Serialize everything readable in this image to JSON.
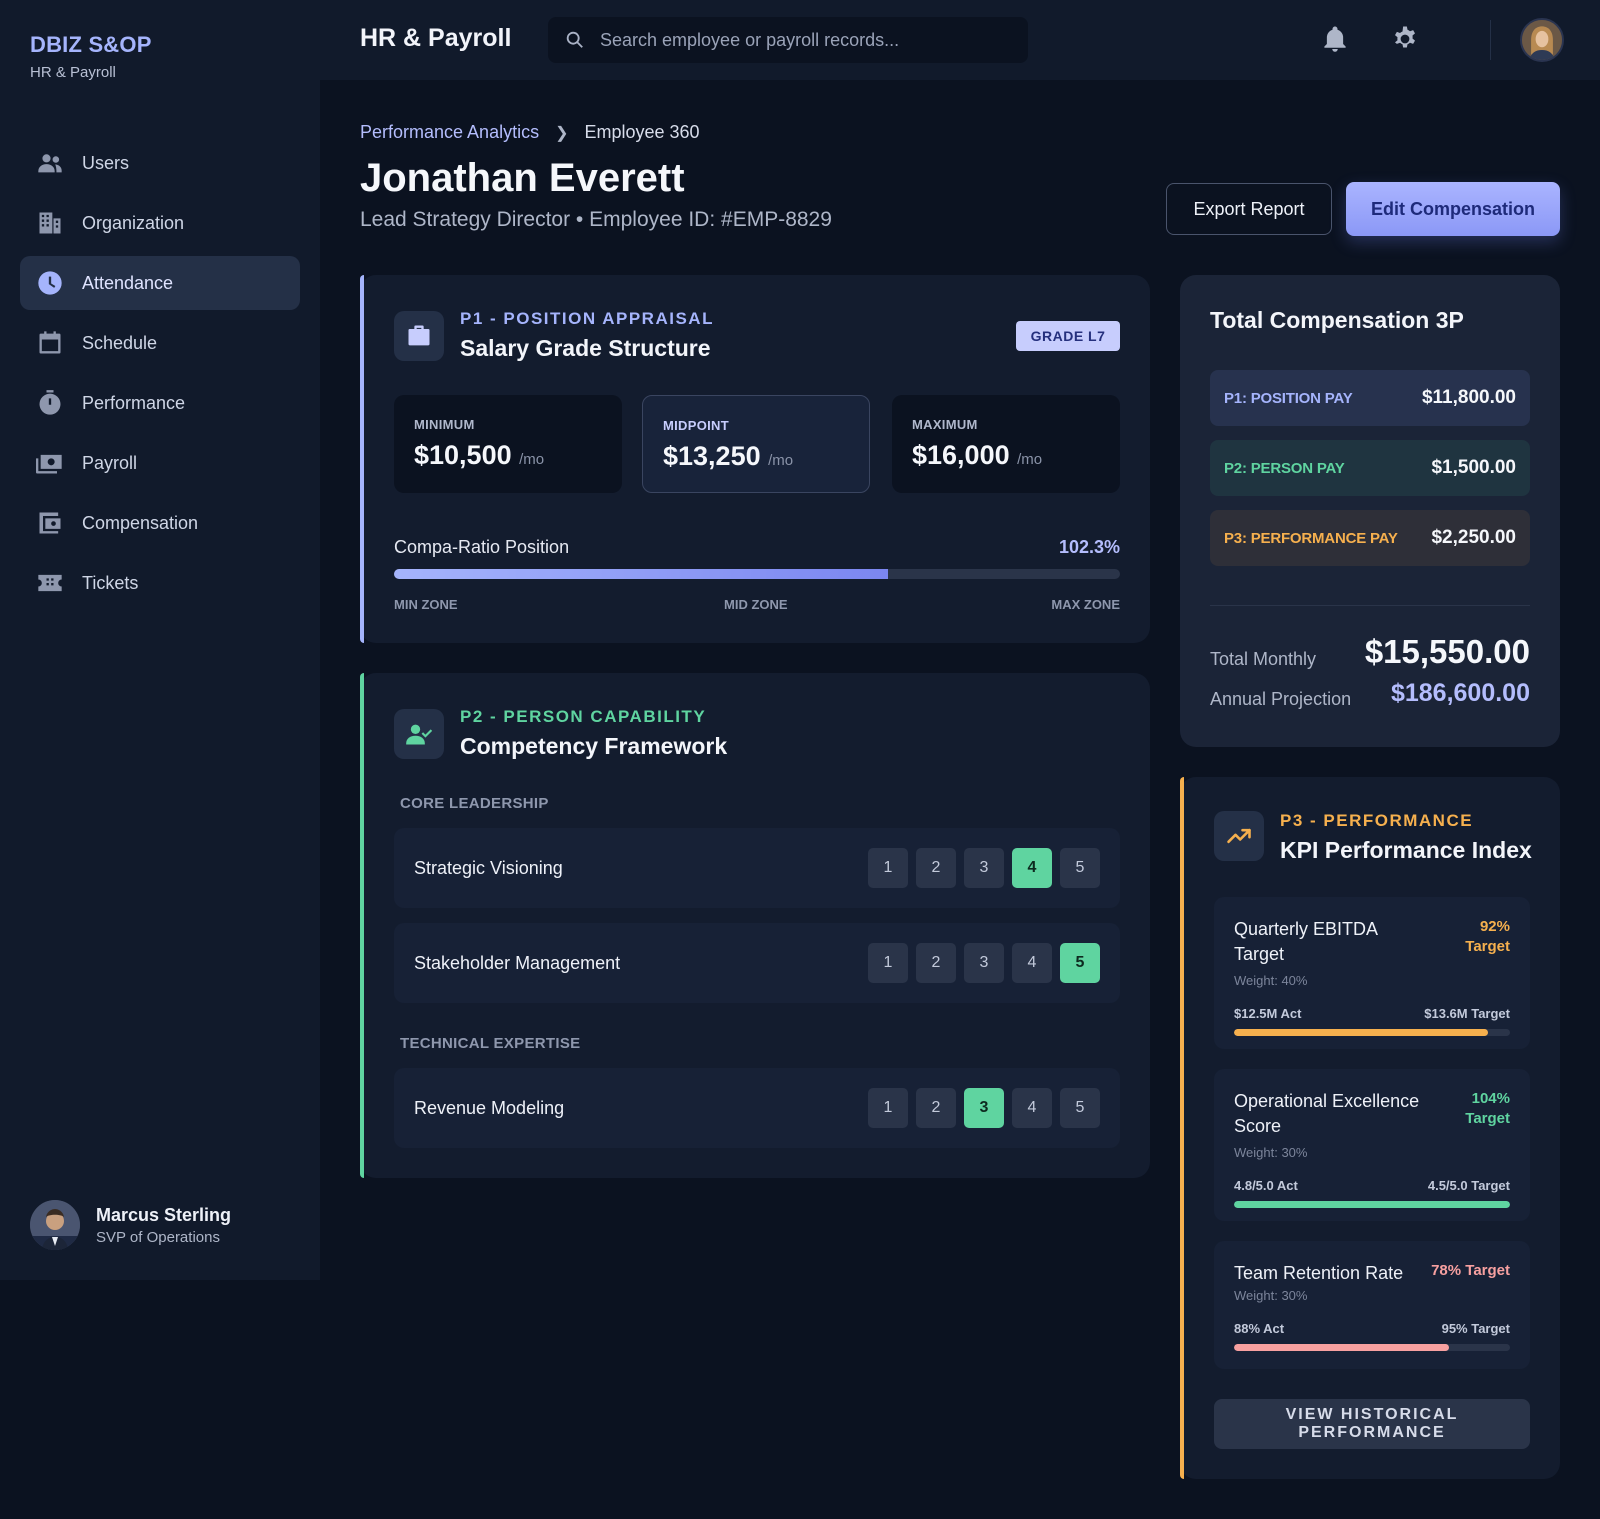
{
  "brand": {
    "name": "DBIZ S&OP",
    "subtitle": "HR & Payroll"
  },
  "sidebar": {
    "items": [
      {
        "label": "Users",
        "icon": "users-icon"
      },
      {
        "label": "Organization",
        "icon": "building-icon"
      },
      {
        "label": "Attendance",
        "icon": "clock-icon",
        "active": true
      },
      {
        "label": "Schedule",
        "icon": "calendar-icon"
      },
      {
        "label": "Performance",
        "icon": "stopwatch-icon"
      },
      {
        "label": "Payroll",
        "icon": "cash-icon"
      },
      {
        "label": "Compensation",
        "icon": "wallet-icon"
      },
      {
        "label": "Tickets",
        "icon": "ticket-icon"
      }
    ],
    "user": {
      "name": "Marcus Sterling",
      "role": "SVP of Operations"
    }
  },
  "topbar": {
    "title": "HR & Payroll",
    "search_placeholder": "Search employee or payroll records..."
  },
  "breadcrumb": {
    "parent": "Performance Analytics",
    "current": "Employee 360"
  },
  "employee": {
    "name": "Jonathan Everett",
    "subtitle": "Lead Strategy Director • Employee ID: #EMP-8829"
  },
  "actions": {
    "export": "Export Report",
    "edit": "Edit Compensation"
  },
  "p1": {
    "kicker": "P1 - POSITION APPRAISAL",
    "title": "Salary Grade Structure",
    "grade": "GRADE L7",
    "stats": [
      {
        "label": "MINIMUM",
        "value": "$10,500",
        "unit": "/mo"
      },
      {
        "label": "MIDPOINT",
        "value": "$13,250",
        "unit": "/mo"
      },
      {
        "label": "MAXIMUM",
        "value": "$16,000",
        "unit": "/mo"
      }
    ],
    "ratio_label": "Compa-Ratio Position",
    "ratio_value": "102.3%",
    "ratio_fill": 0.68,
    "zones": [
      "MIN ZONE",
      "MID ZONE",
      "MAX ZONE"
    ]
  },
  "p2": {
    "kicker": "P2 - PERSON CAPABILITY",
    "title": "Competency Framework",
    "sections": [
      {
        "label": "CORE LEADERSHIP"
      },
      {
        "label": "TECHNICAL EXPERTISE"
      }
    ],
    "skills": [
      {
        "name": "Strategic Visioning",
        "level": 4
      },
      {
        "name": "Stakeholder Management",
        "level": 5
      },
      {
        "name": "Revenue Modeling",
        "level": 3
      }
    ],
    "levels": [
      "1",
      "2",
      "3",
      "4",
      "5"
    ]
  },
  "comp": {
    "title": "Total Compensation 3P",
    "rows": [
      {
        "label": "P1: POSITION PAY",
        "value": "$11,800.00"
      },
      {
        "label": "P2: PERSON PAY",
        "value": "$1,500.00"
      },
      {
        "label": "P3: PERFORMANCE PAY",
        "value": "$2,250.00"
      }
    ],
    "total_label": "Total Monthly",
    "total_value": "$15,550.00",
    "annual_label": "Annual Projection",
    "annual_value": "$186,600.00"
  },
  "p3": {
    "kicker": "P3 - PERFORMANCE",
    "title": "KPI Performance Index",
    "kpis": [
      {
        "name": "Quarterly EBITDA Target",
        "pct": "92% Target",
        "weight": "Weight: 40%",
        "actual": "$12.5M Act",
        "target": "$13.6M Target",
        "progress": 0.92,
        "color": "#f6b04e"
      },
      {
        "name": "Operational Excellence Score",
        "pct": "104% Target",
        "weight": "Weight: 30%",
        "actual": "4.8/5.0 Act",
        "target": "4.5/5.0 Target",
        "progress": 1.0,
        "color": "#5fd4a0"
      },
      {
        "name": "Team Retention Rate",
        "pct": "78% Target",
        "weight": "Weight: 30%",
        "actual": "88% Act",
        "target": "95% Target",
        "progress": 0.78,
        "color": "#f7a0a0"
      }
    ],
    "history_button": "VIEW HISTORICAL PERFORMANCE"
  },
  "colors": {
    "accent": "#a5b4fc",
    "p1": "#a5b4fc",
    "p2": "#5fd4a0",
    "p3": "#f6b04e",
    "background": "#0b1220"
  }
}
